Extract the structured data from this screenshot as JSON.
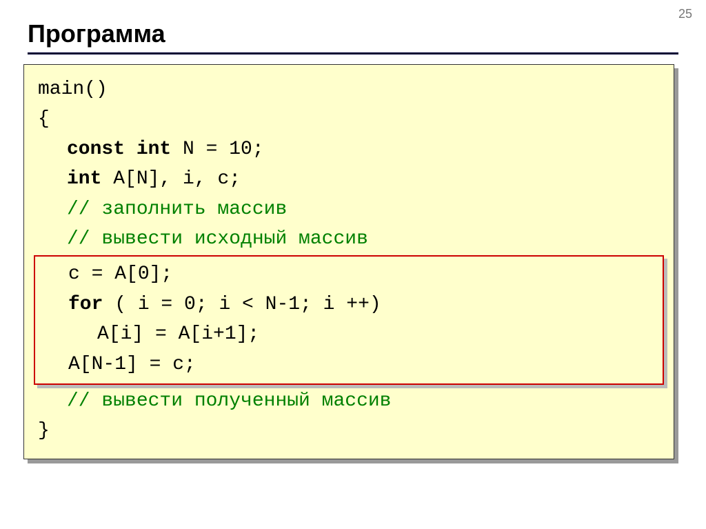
{
  "page_number": "25",
  "title": "Программа",
  "code": {
    "l1": "main()",
    "l2": "{",
    "l3a": "const int",
    "l3b": " N = 10;",
    "l4a": "int",
    "l4b": " A[N], i, c;",
    "l5": "// заполнить массив",
    "l6": "// вывести исходный массив",
    "h1": "c = A[0];",
    "h2a": "for",
    "h2b": " ( i = 0; i < N-1; i ++)",
    "h3": "A[i] = A[i+1];",
    "h4": "A[N-1] = c;",
    "l7": "// вывести полученный массив",
    "l8": "}"
  }
}
